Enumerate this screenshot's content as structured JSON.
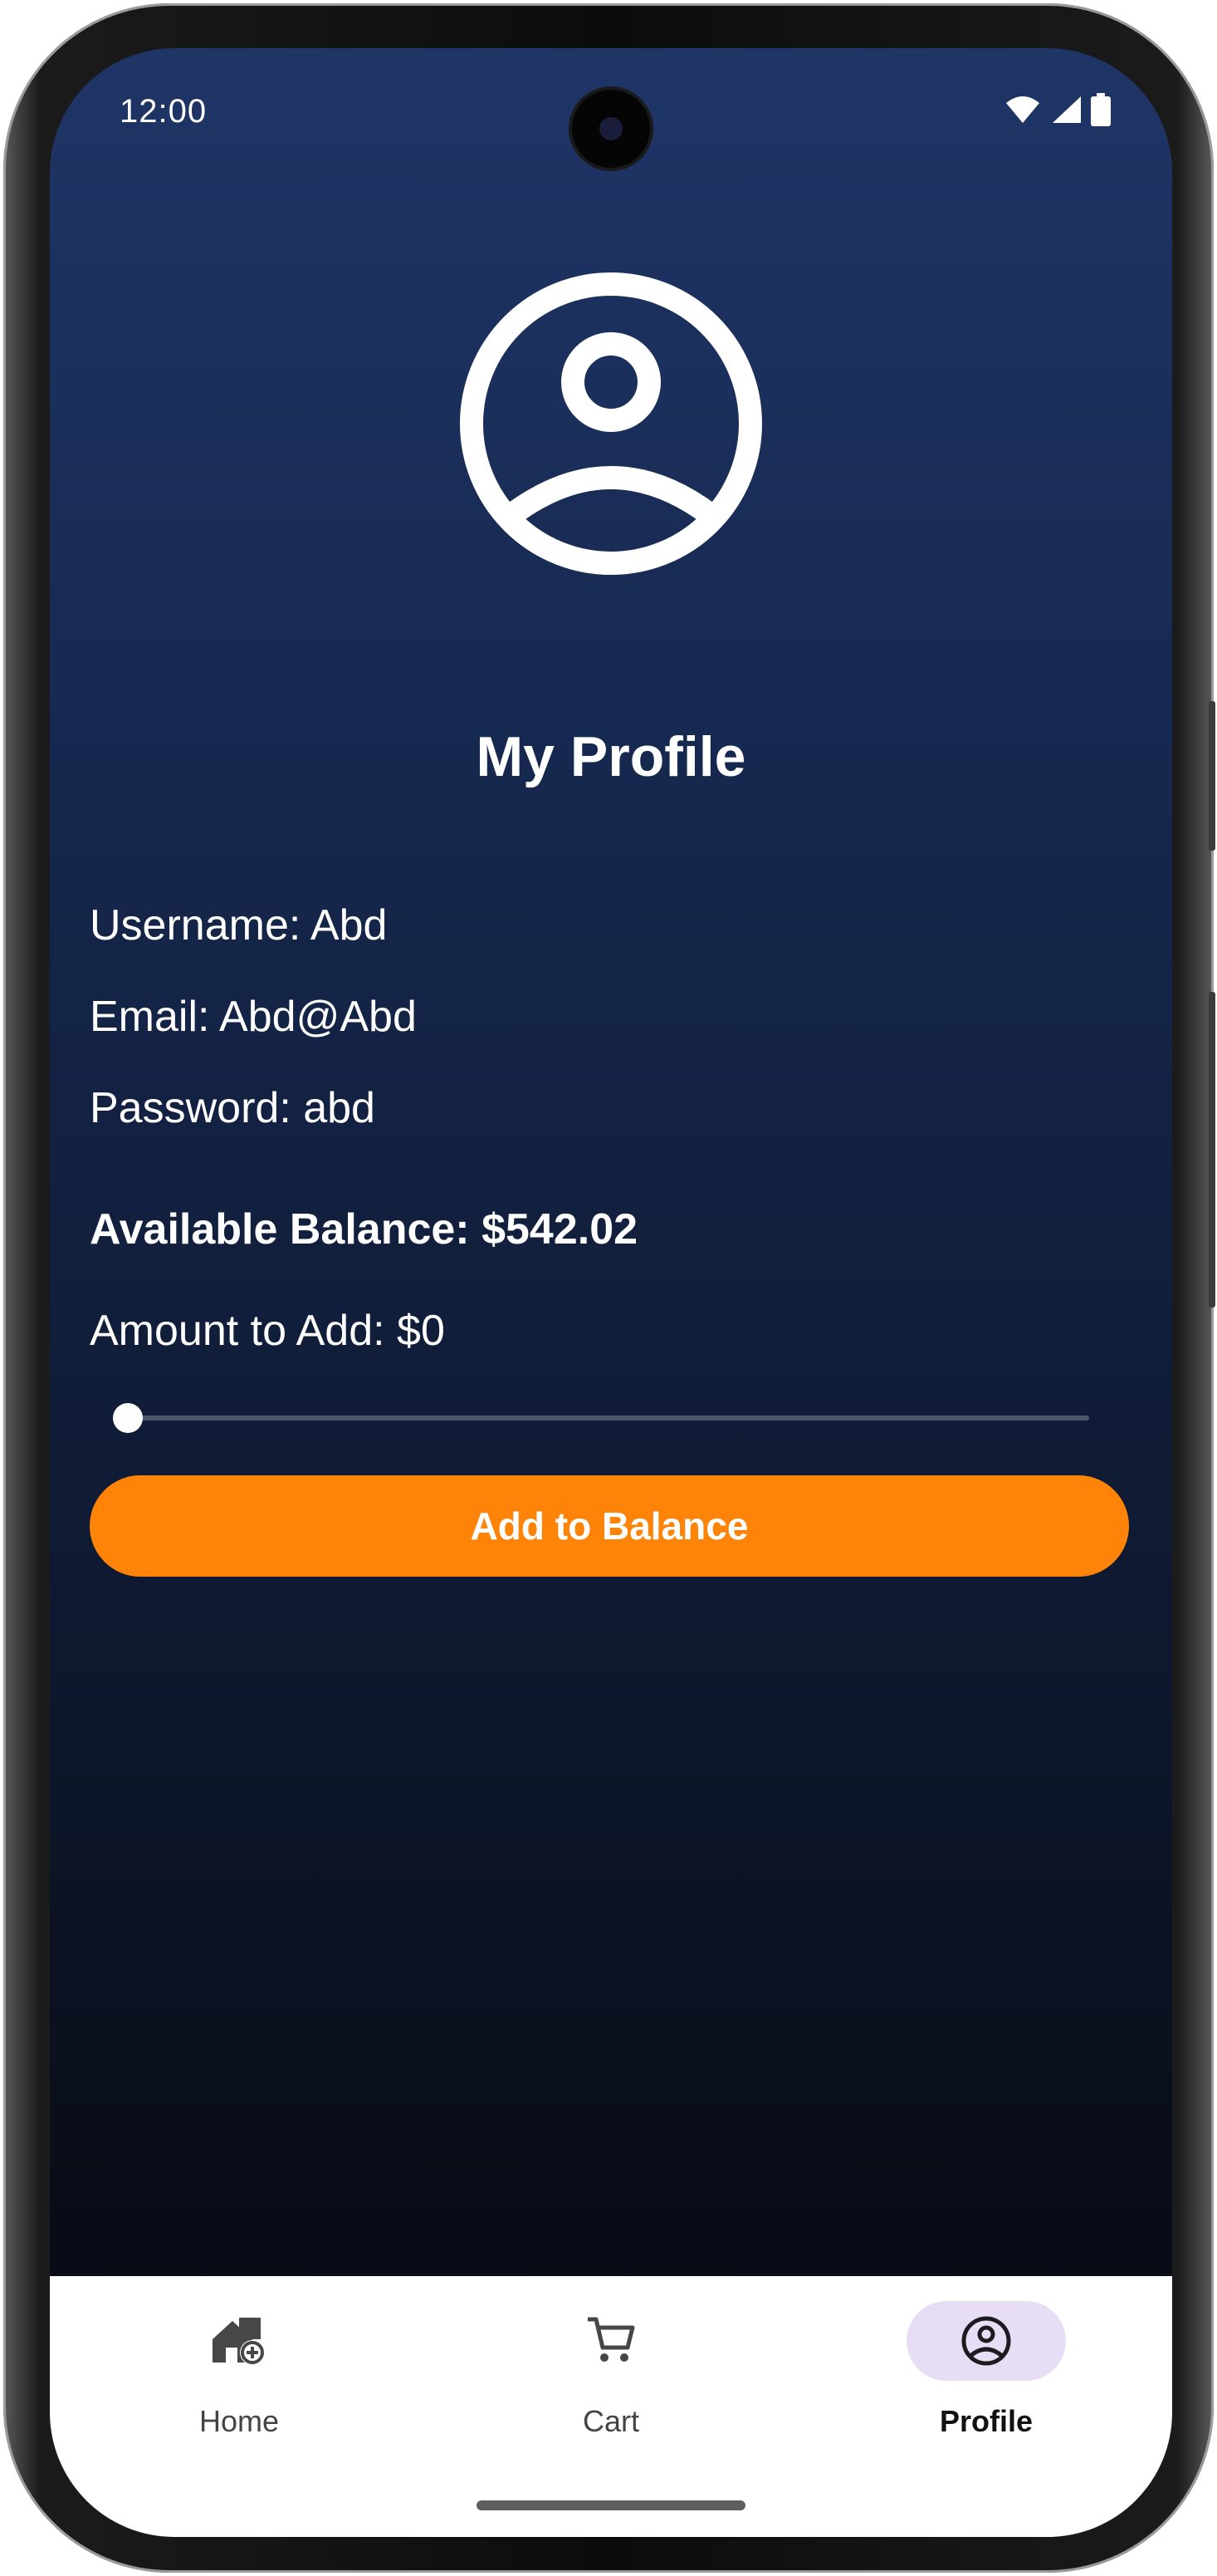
{
  "status_bar": {
    "time": "12:00",
    "icons": [
      "wifi-icon",
      "cell-signal-icon",
      "battery-icon"
    ]
  },
  "profile": {
    "avatar_icon": "account-circle-icon",
    "title": "My Profile",
    "username": "Username: Abd",
    "email": "Email: Abd@Abd",
    "password": "Password: abd",
    "balance": "Available Balance: $542.02",
    "amount_to_add": "Amount to Add: $0",
    "slider_value": 0,
    "add_button_label": "Add to Balance"
  },
  "bottom_nav": {
    "items": [
      {
        "label": "Home",
        "icon": "home-add-icon",
        "active": false
      },
      {
        "label": "Cart",
        "icon": "cart-icon",
        "active": false
      },
      {
        "label": "Profile",
        "icon": "account-circle-icon",
        "active": true
      }
    ]
  },
  "colors": {
    "accent": "#fd8409",
    "background_top": "#1f3566",
    "background_bottom": "#070910",
    "nav_active_pill": "#e7def5"
  }
}
